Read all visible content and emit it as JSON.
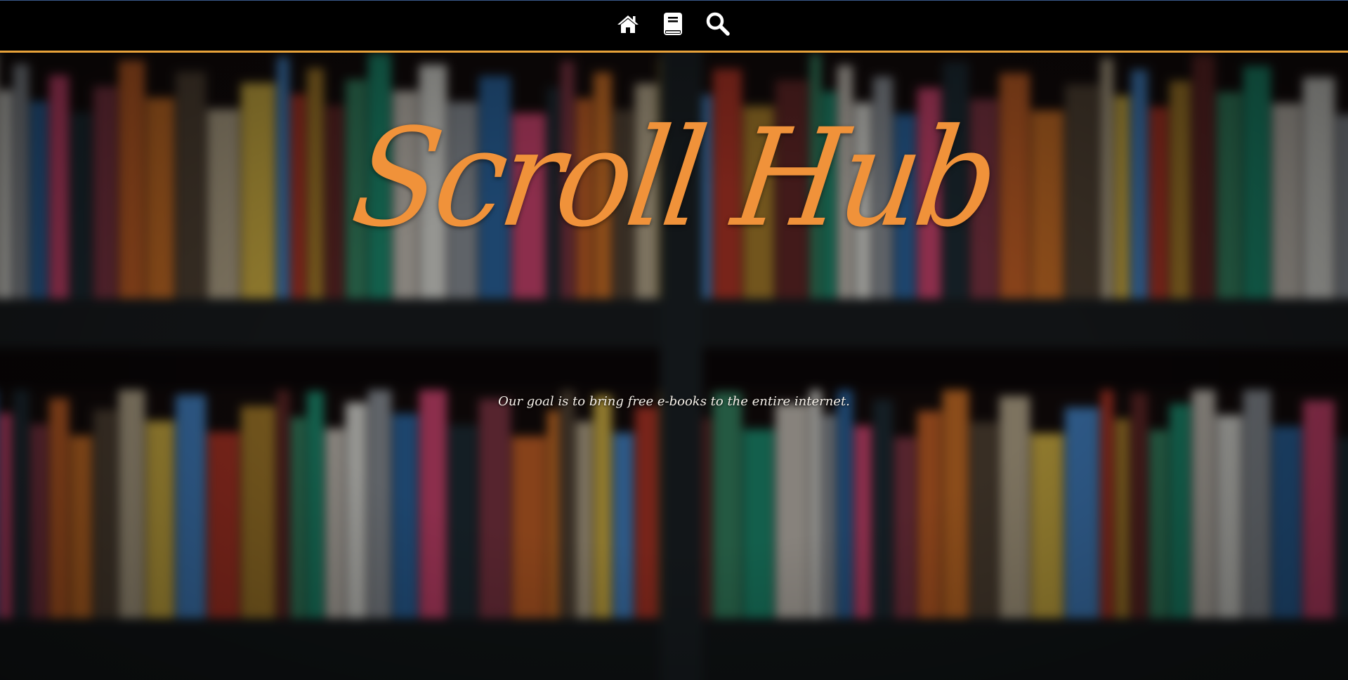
{
  "nav": {
    "items": [
      {
        "icon": "home-icon",
        "label": ""
      },
      {
        "icon": "book-icon",
        "label": ""
      },
      {
        "icon": "search-icon",
        "label": ""
      }
    ]
  },
  "hero": {
    "title": "Scroll Hub",
    "tagline": "Our goal is to bring free e-books to the entire internet."
  },
  "colors": {
    "accent": "#f0923a",
    "nav_border": "#e8a23a",
    "topbar_bg": "#000000",
    "icon": "#ffffff"
  }
}
